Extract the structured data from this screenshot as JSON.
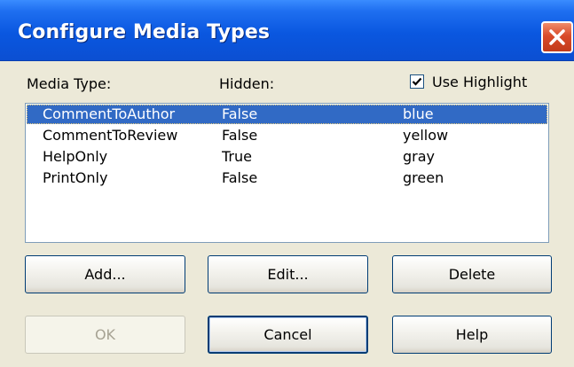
{
  "window": {
    "title": "Configure Media Types"
  },
  "headers": {
    "media_type": "Media Type:",
    "hidden": "Hidden:"
  },
  "use_highlight": {
    "label": "Use Highlight",
    "checked": true
  },
  "list": {
    "rows": [
      {
        "name": "CommentToAuthor",
        "hidden": "False",
        "color": "blue",
        "selected": true
      },
      {
        "name": "CommentToReview",
        "hidden": "False",
        "color": "yellow",
        "selected": false
      },
      {
        "name": "HelpOnly",
        "hidden": "True",
        "color": "gray",
        "selected": false
      },
      {
        "name": "PrintOnly",
        "hidden": "False",
        "color": "green",
        "selected": false
      }
    ]
  },
  "buttons": {
    "add": "Add...",
    "edit": "Edit...",
    "delete": "Delete",
    "ok": "OK",
    "cancel": "Cancel",
    "help": "Help"
  },
  "colors": {
    "titlebar": "#0a57e0",
    "selection": "#316ac5",
    "close": "#d94b2a",
    "dialog_bg": "#ece9d8"
  }
}
